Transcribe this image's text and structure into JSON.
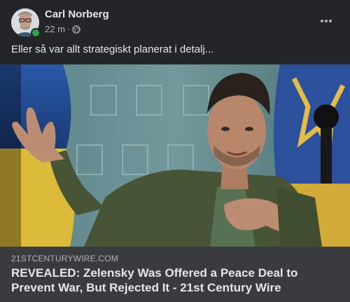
{
  "post": {
    "author": "Carl Norberg",
    "time": "22 m",
    "separator": "·",
    "text": "Eller så var allt strategiskt planerat i detalj...",
    "more_icon": "more-horizontal-icon",
    "audience_icon": "globe-icon"
  },
  "link": {
    "domain": "21STCENTURYWIRE.COM",
    "title": "REVEALED: Zelensky Was Offered a Peace Deal to Prevent War, But Rejected It - 21st Century Wire"
  },
  "colors": {
    "background": "#242526",
    "link_bar": "#3a3b3c",
    "online": "#31a24c",
    "text_primary": "#e4e6eb",
    "text_secondary": "#b0b3b8"
  }
}
